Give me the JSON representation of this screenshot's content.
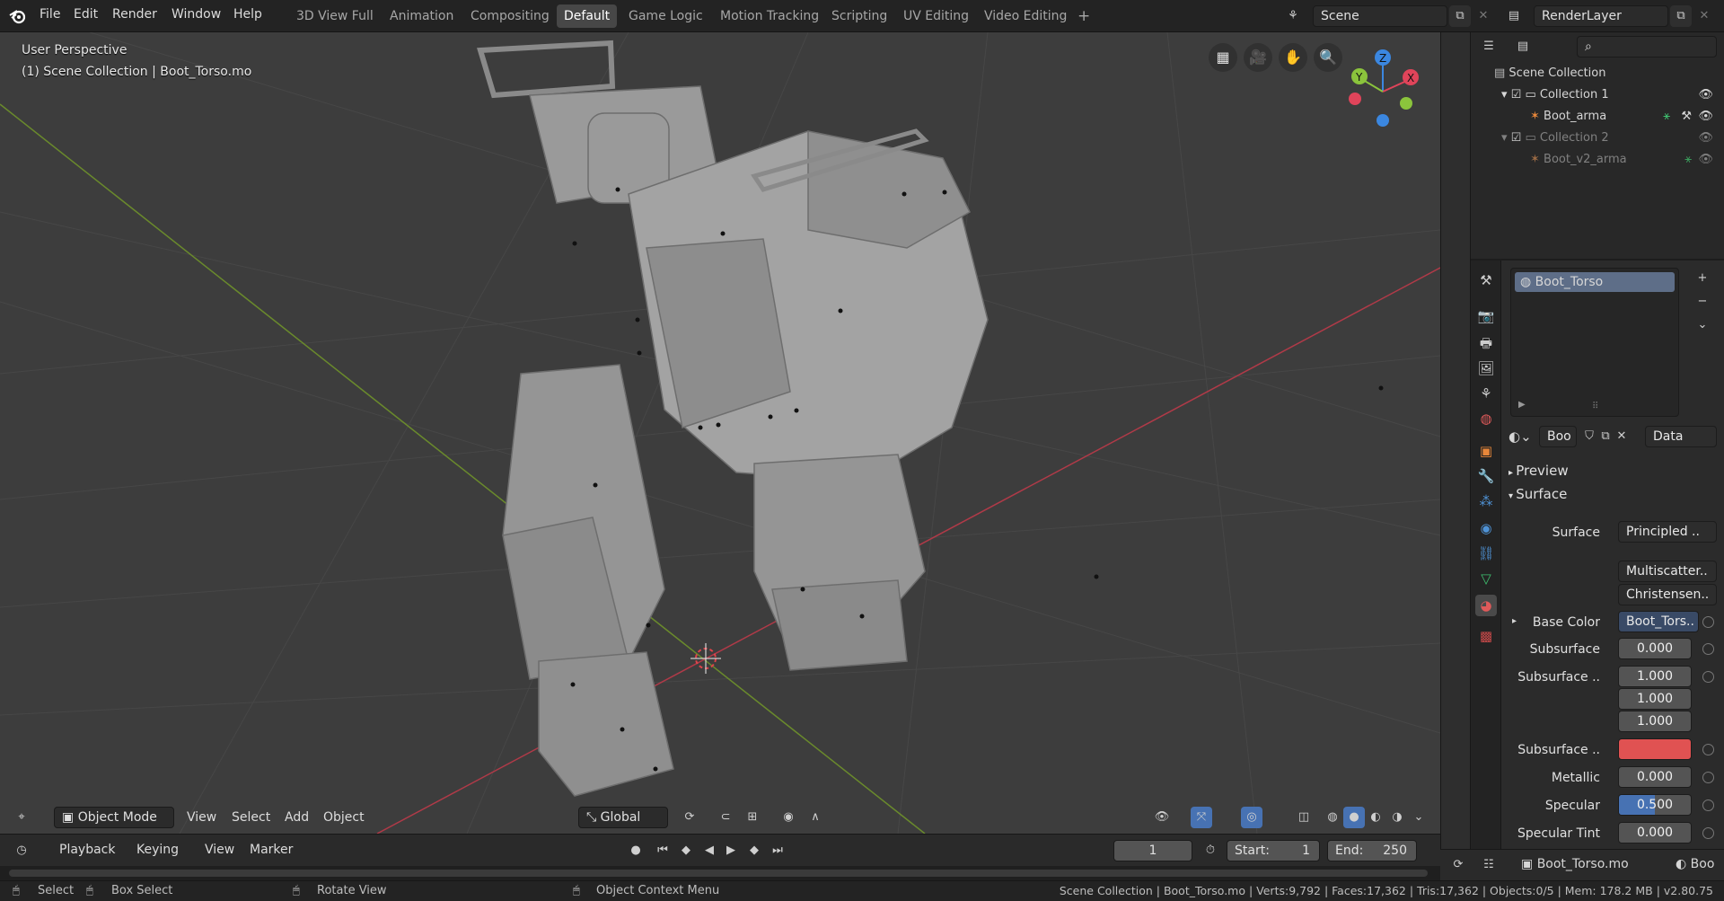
{
  "topbar": {
    "menus": [
      "File",
      "Edit",
      "Render",
      "Window",
      "Help"
    ],
    "workspaces": [
      "3D View Full",
      "Animation",
      "Compositing",
      "Default",
      "Game Logic",
      "Motion Tracking",
      "Scripting",
      "UV Editing",
      "Video Editing"
    ],
    "active_workspace": "Default",
    "add_tab_symbol": "+",
    "scene": "Scene",
    "render_layer": "RenderLayer"
  },
  "viewport": {
    "perspective": "User Perspective",
    "collection_info": "(1) Scene Collection | Boot_Torso.mo",
    "gizmo": {
      "x": "X",
      "y": "Y",
      "z": "Z"
    },
    "header": {
      "mode": "Object Mode",
      "menus": [
        "View",
        "Select",
        "Add",
        "Object"
      ],
      "transform_orientation": "Global"
    }
  },
  "timeline": {
    "menus": [
      "Playback",
      "Keying",
      "View",
      "Marker"
    ],
    "current_frame": "1",
    "start_label": "Start:",
    "start": "1",
    "end_label": "End:",
    "end": "250"
  },
  "statusbar": {
    "select": "Select",
    "box_select": "Box Select",
    "rotate_view": "Rotate View",
    "context_menu": "Object Context Menu",
    "stats": "Scene Collection | Boot_Torso.mo | Verts:9,792 | Faces:17,362 | Tris:17,362 | Objects:0/5 | Mem: 178.2 MB | v2.80.75"
  },
  "outliner": {
    "root": "Scene Collection",
    "rows": [
      {
        "label": "Collection 1",
        "type": "collection",
        "enabled": true
      },
      {
        "label": "Boot_arma",
        "type": "armature",
        "enabled": true
      },
      {
        "label": "Collection 2",
        "type": "collection",
        "enabled": false
      },
      {
        "label": "Boot_v2_arma",
        "type": "armature",
        "enabled": false
      }
    ]
  },
  "properties": {
    "material_slot": "Boot_Torso",
    "material_name": "Boo",
    "link_mode": "Data",
    "panels": {
      "preview": "Preview",
      "surface": "Surface"
    },
    "rows": [
      {
        "label": "Surface",
        "value": "Principled ..",
        "kind": "dropdown"
      },
      {
        "label": "",
        "value": "Multiscatter..",
        "kind": "select"
      },
      {
        "label": "",
        "value": "Christensen..",
        "kind": "select"
      },
      {
        "label": "Base Color",
        "value": "Boot_Tors..",
        "kind": "link"
      },
      {
        "label": "Subsurface",
        "value": "0.000",
        "kind": "number"
      },
      {
        "label": "Subsurface ..",
        "value": "1.000",
        "kind": "number"
      },
      {
        "label": "",
        "value": "1.000",
        "kind": "number"
      },
      {
        "label": "",
        "value": "1.000",
        "kind": "number"
      },
      {
        "label": "Subsurface ..",
        "value": "",
        "kind": "color"
      },
      {
        "label": "Metallic",
        "value": "0.000",
        "kind": "number"
      },
      {
        "label": "Specular",
        "value": "0.500",
        "kind": "slider",
        "fraction": 0.5
      },
      {
        "label": "Specular Tint",
        "value": "0.000",
        "kind": "number"
      }
    ],
    "footer_object": "Boot_Torso.mo",
    "footer_extra": "Boo"
  },
  "colors": {
    "accent": "#4772b3",
    "subsurface_color": "#e05252",
    "axis_x": "#e0445a",
    "axis_y": "#8bc43c",
    "axis_z": "#3b87e0",
    "armature": "#e8873a"
  }
}
